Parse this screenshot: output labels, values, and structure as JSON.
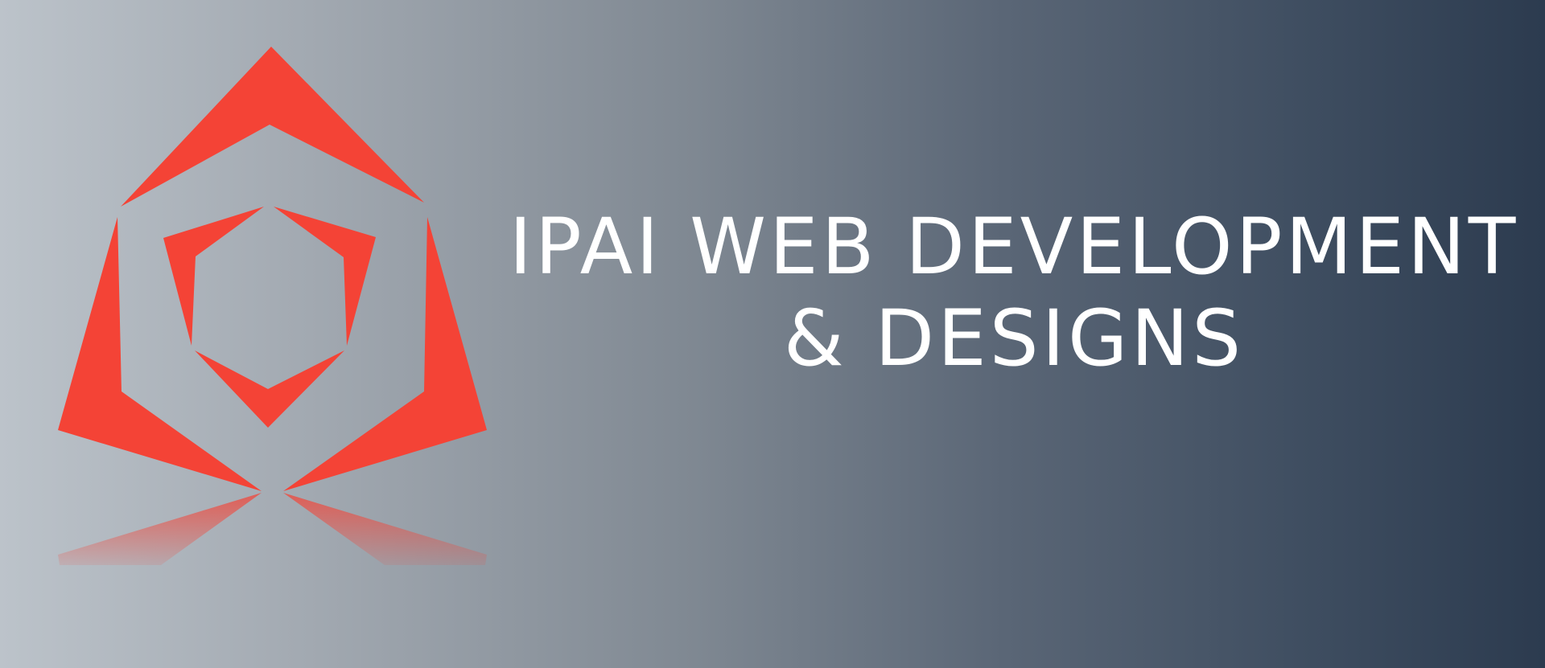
{
  "banner": {
    "title_line_1": "IPAI WEB DEVELOPMENT",
    "title_line_2": "& DESIGNS"
  },
  "colors": {
    "logo_red": "#f44336",
    "text": "#ffffff",
    "gradient_start": "#bcc3ca",
    "gradient_end": "#2c3b4f"
  },
  "logo": {
    "icon": "geometric-house-logo-icon"
  }
}
